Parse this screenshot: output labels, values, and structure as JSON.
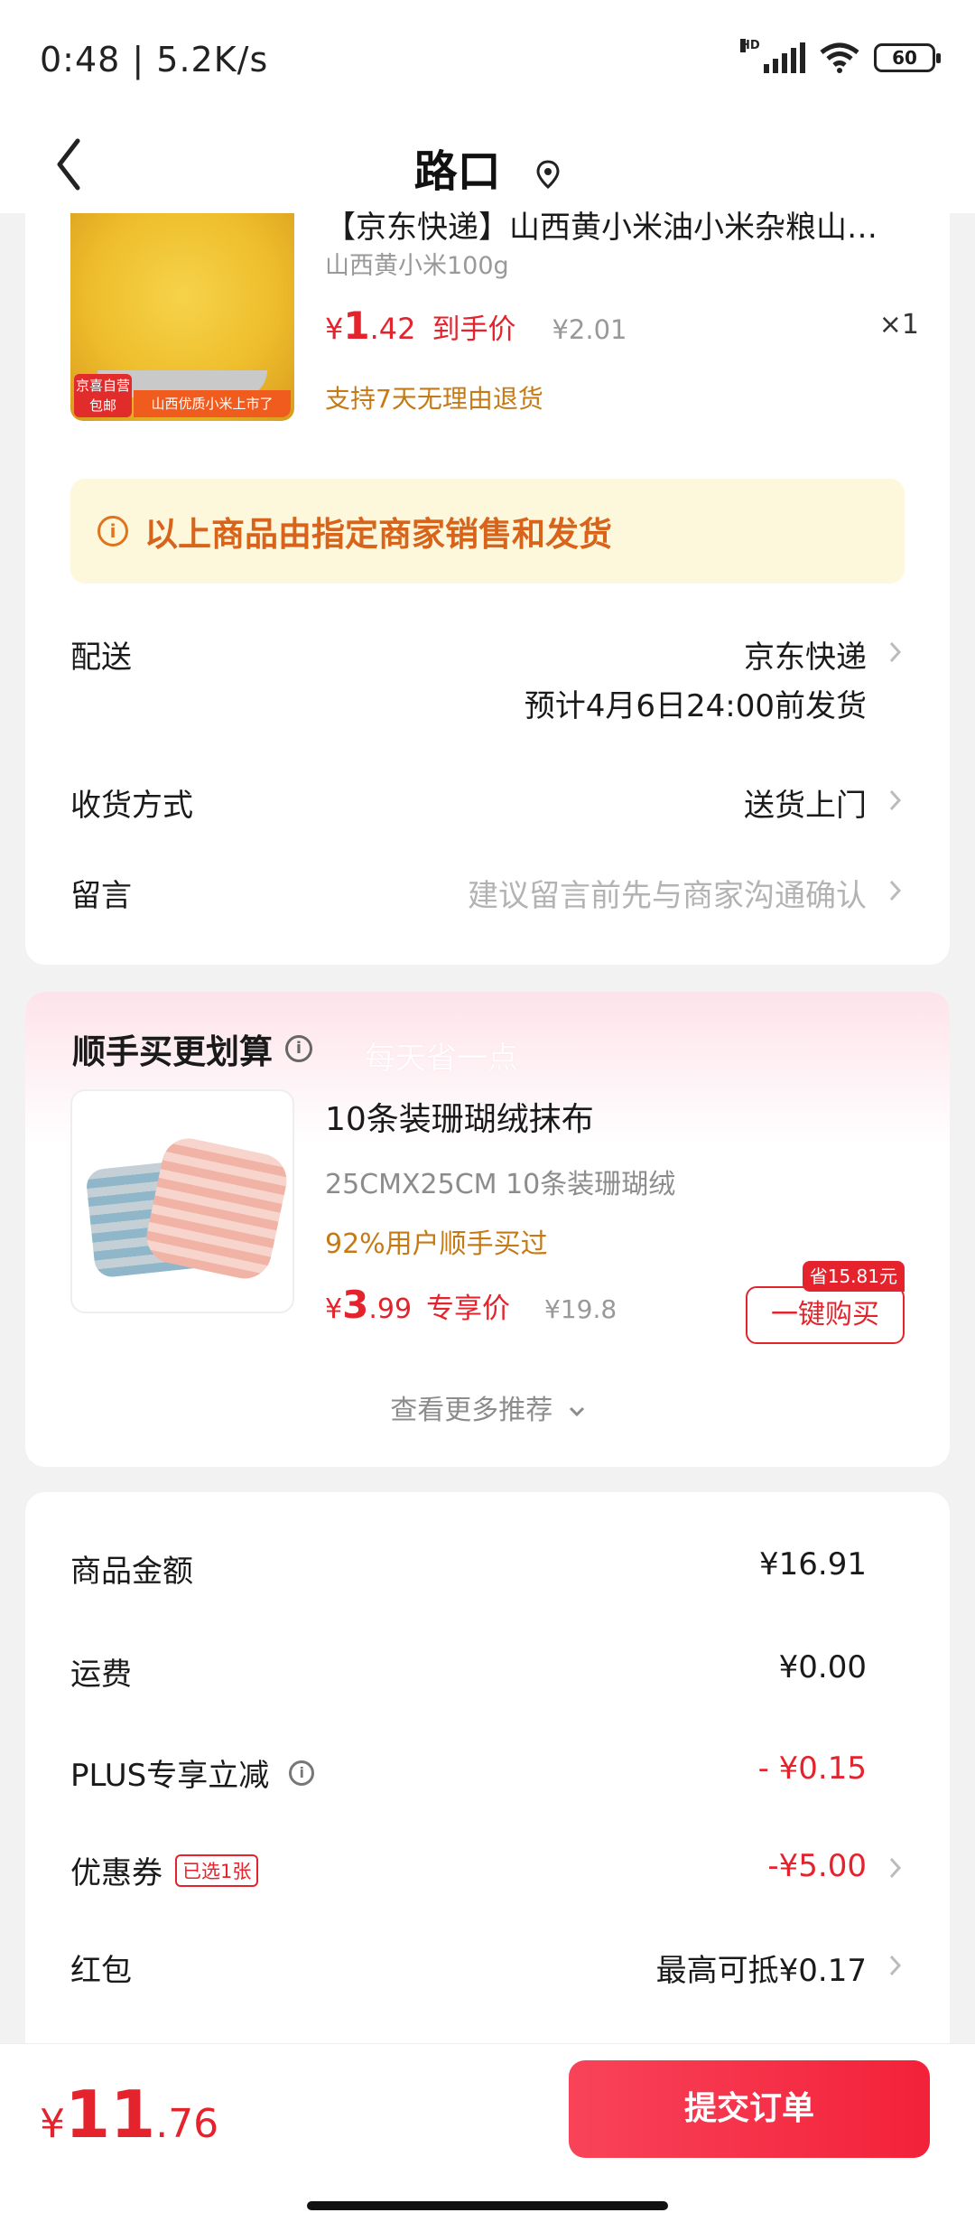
{
  "status": {
    "time": "0:48 | 5.2K/s",
    "network": "HD",
    "battery": "60"
  },
  "header": {
    "title": "路口"
  },
  "product": {
    "title": "【京东快递】山西黄小米油小米杂粮山…",
    "spec": "山西黄小米100g",
    "price_yen": "¥",
    "price_int": "1",
    "price_dec": ".42",
    "price_label": "到手价",
    "original_price": "¥2.01",
    "quantity": "×1",
    "return_policy": "支持7天无理由退货",
    "img_tag_top": "京喜自营",
    "img_tag_bottom": "包邮",
    "img_banner": "山西优质小米上市了"
  },
  "notice": {
    "text": "以上商品由指定商家销售和发货"
  },
  "shipping": {
    "delivery_label": "配送",
    "delivery_value": "京东快递",
    "delivery_eta": "预计4月6日24:00前发货",
    "method_label": "收货方式",
    "method_value": "送货上门",
    "message_label": "留言",
    "message_placeholder": "建议留言前先与商家沟通确认"
  },
  "recommend": {
    "title": "顺手买更划算",
    "watermark": "每天省一点",
    "item_name": "10条装珊瑚绒抹布",
    "item_spec": "25CMX25CM 10条装珊瑚绒",
    "bought_text": "92%用户顺手买过",
    "price_yen": "¥",
    "price_int": "3",
    "price_dec": ".99",
    "price_label": "专享价",
    "original_price": "¥19.8",
    "save_badge": "省15.81元",
    "buy_button": "一键购买",
    "more_label": "查看更多推荐"
  },
  "summary": {
    "goods_label": "商品金额",
    "goods_value": "¥16.91",
    "freight_label": "运费",
    "freight_value": "¥0.00",
    "plus_label": "PLUS专享立减",
    "plus_value": "- ¥0.15",
    "coupon_label": "优惠券",
    "coupon_tag": "已选1张",
    "coupon_value": "-¥5.00",
    "redpacket_label": "红包",
    "redpacket_value": "最高可抵¥0.17"
  },
  "footer": {
    "total_yen": "¥",
    "total_int": "11",
    "total_dec": ".76",
    "submit_label": "提交订单"
  },
  "colors": {
    "accent": "#e4232c",
    "warning_text": "#d8631a",
    "gold_text": "#c57a16"
  }
}
